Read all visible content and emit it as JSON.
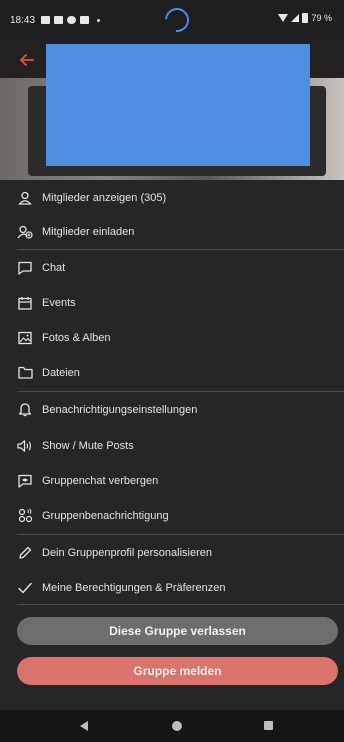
{
  "status_bar": {
    "time": "18:43",
    "battery": "79 %"
  },
  "header": {
    "back_icon": "arrow-left-icon"
  },
  "menu": {
    "items": [
      {
        "label": "Mitglieder anzeigen (305)",
        "icon": "person-icon"
      },
      {
        "label": "Mitglieder einladen",
        "icon": "add-person-icon"
      },
      {
        "label": "Chat",
        "icon": "chat-icon"
      },
      {
        "label": "Events",
        "icon": "calendar-icon"
      },
      {
        "label": "Fotos & Alben",
        "icon": "image-icon"
      },
      {
        "label": "Dateien",
        "icon": "folder-icon"
      },
      {
        "label": "Benachrichtigungseinstellungen",
        "icon": "bell-icon"
      },
      {
        "label": "Show / Mute Posts",
        "icon": "speaker-icon"
      },
      {
        "label": "Gruppenchat verbergen",
        "icon": "chat-hide-icon"
      },
      {
        "label": "Gruppenbenachrichtigung",
        "icon": "group-notify-icon"
      },
      {
        "label": "Dein Gruppenprofil personalisieren",
        "icon": "pencil-icon"
      },
      {
        "label": "Meine Berechtigungen & Präferenzen",
        "icon": "check-icon"
      }
    ]
  },
  "actions": {
    "leave_label": "Diese Gruppe verlassen",
    "report_label": "Gruppe melden"
  },
  "colors": {
    "sheet_bg": "#262626",
    "leave_button": "#6d6d6d",
    "report_button": "#d9736b",
    "back_arrow": "#e8503a",
    "spinner": "#4a8df0"
  }
}
